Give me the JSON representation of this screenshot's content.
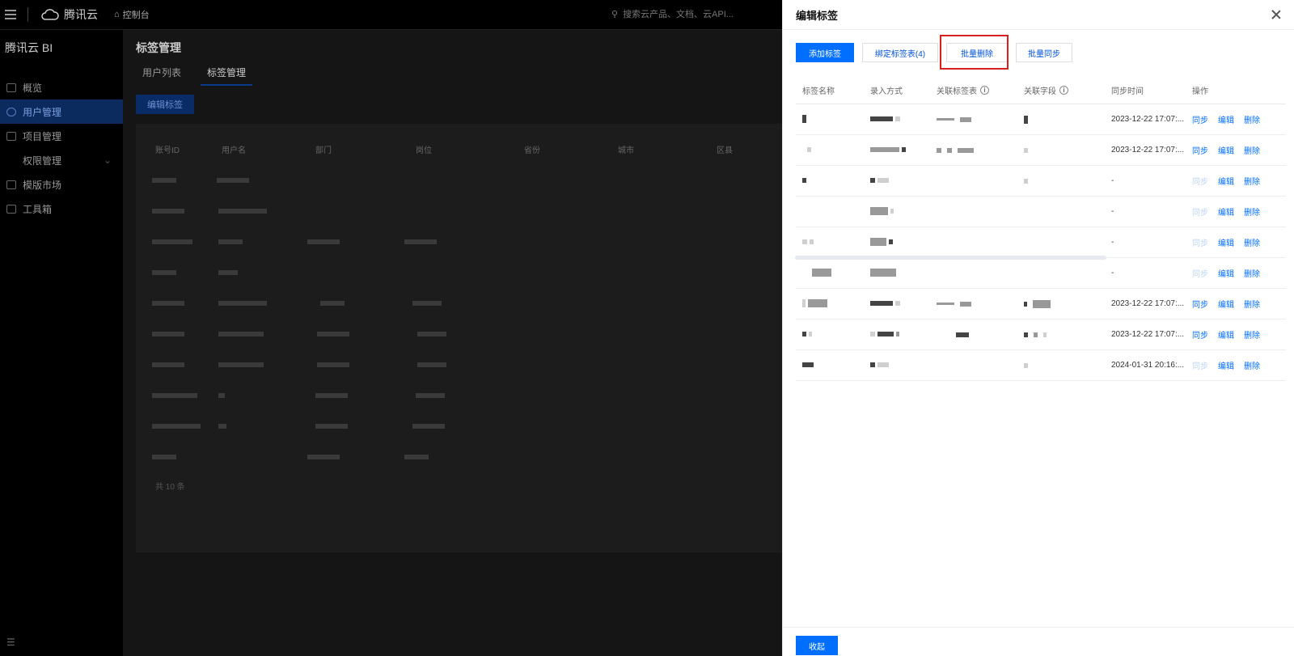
{
  "topbar": {
    "brand": "腾讯云",
    "console": "控制台",
    "search_placeholder": "搜索云产品、文档、云API..."
  },
  "sidebar": {
    "title": "腾讯云 BI",
    "items": [
      {
        "label": "概览",
        "icon": "grid-icon"
      },
      {
        "label": "用户管理",
        "icon": "user-icon",
        "active": true
      },
      {
        "label": "项目管理",
        "icon": "folder-icon"
      },
      {
        "label": "权限管理",
        "icon": "chevron-down-icon",
        "sub": true
      },
      {
        "label": "模版市场",
        "icon": "template-icon"
      },
      {
        "label": "工具箱",
        "icon": "toolbox-icon"
      }
    ]
  },
  "main": {
    "title": "标签管理",
    "tabs": [
      "用户列表",
      "标签管理"
    ],
    "edit_button": "编辑标签",
    "columns": [
      "账号ID",
      "用户名",
      "部门",
      "岗位",
      "省份",
      "城市",
      "区县"
    ],
    "footer": "共 10 条"
  },
  "drawer": {
    "title": "编辑标签",
    "buttons": {
      "add": "添加标签",
      "bind": "绑定标签表(4)",
      "batch_delete": "批量删除",
      "batch_sync": "批量同步"
    },
    "columns": {
      "name": "标签名称",
      "input_mode": "录入方式",
      "related_table": "关联标签表",
      "related_field": "关联字段",
      "sync_time": "同步时间",
      "actions": "操作"
    },
    "action_labels": {
      "sync": "同步",
      "edit": "编辑",
      "delete": "删除"
    },
    "rows": [
      {
        "sync_time": "2023-12-22 17:07:...",
        "sync_enabled": true
      },
      {
        "sync_time": "2023-12-22 17:07:...",
        "sync_enabled": true
      },
      {
        "sync_time": "-",
        "sync_enabled": false
      },
      {
        "sync_time": "-",
        "sync_enabled": false
      },
      {
        "sync_time": "-",
        "sync_enabled": false
      },
      {
        "sync_time": "-",
        "sync_enabled": false
      },
      {
        "sync_time": "2023-12-22 17:07:...",
        "sync_enabled": true
      },
      {
        "sync_time": "2023-12-22 17:07:...",
        "sync_enabled": true
      },
      {
        "sync_time": "2024-01-31 20:16:...",
        "sync_enabled": false
      }
    ],
    "collapse_button": "收起"
  },
  "colors": {
    "primary": "#006eff",
    "highlight": "#d8201f",
    "link_disabled": "#bcd4f5"
  }
}
